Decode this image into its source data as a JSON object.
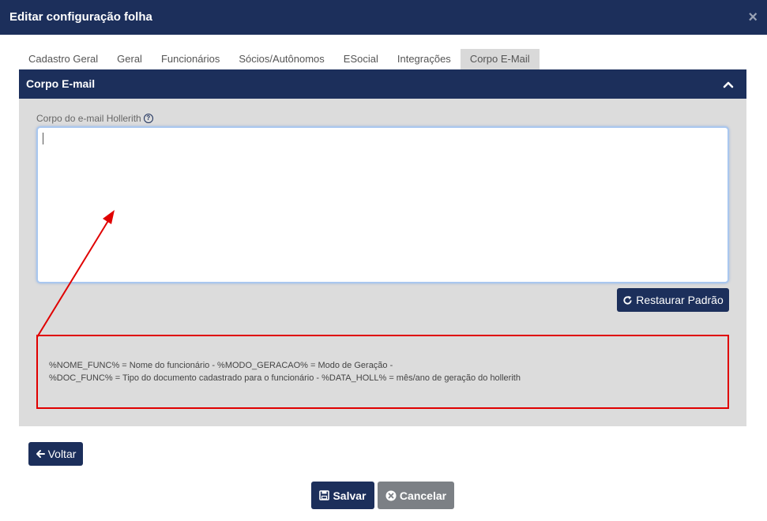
{
  "dialog": {
    "title": "Editar configuração folha",
    "close_label": "×"
  },
  "tabs": [
    {
      "label": "Cadastro Geral",
      "active": false
    },
    {
      "label": "Geral",
      "active": false
    },
    {
      "label": "Funcionários",
      "active": false
    },
    {
      "label": "Sócios/Autônomos",
      "active": false
    },
    {
      "label": "ESocial",
      "active": false
    },
    {
      "label": "Integrações",
      "active": false
    },
    {
      "label": "Corpo E-Mail",
      "active": true
    }
  ],
  "panel": {
    "title": "Corpo E-mail",
    "collapse_icon": "chevron-up-icon"
  },
  "email_body": {
    "label": "Corpo do e-mail Hollerith",
    "help_icon": "question-circle-icon",
    "value": "",
    "restore_button": "Restaurar Padrão",
    "restore_icon": "refresh-icon"
  },
  "variables": {
    "line1": "%NOME_FUNC% = Nome do funcionário - %MODO_GERACAO% = Modo de Geração -",
    "line2": "%DOC_FUNC% = Tipo do documento cadastrado para o funcionário - %DATA_HOLL% = mês/ano de geração do hollerith"
  },
  "footer": {
    "back_label": "Voltar",
    "back_icon": "arrow-left-icon",
    "save_label": "Salvar",
    "save_icon": "floppy-disk-icon",
    "cancel_label": "Cancelar",
    "cancel_icon": "times-circle-icon"
  },
  "colors": {
    "primary": "#1c2f5b",
    "panel_bg": "#dcdcdc",
    "cancel": "#7c8085",
    "annotation": "#e00000"
  }
}
